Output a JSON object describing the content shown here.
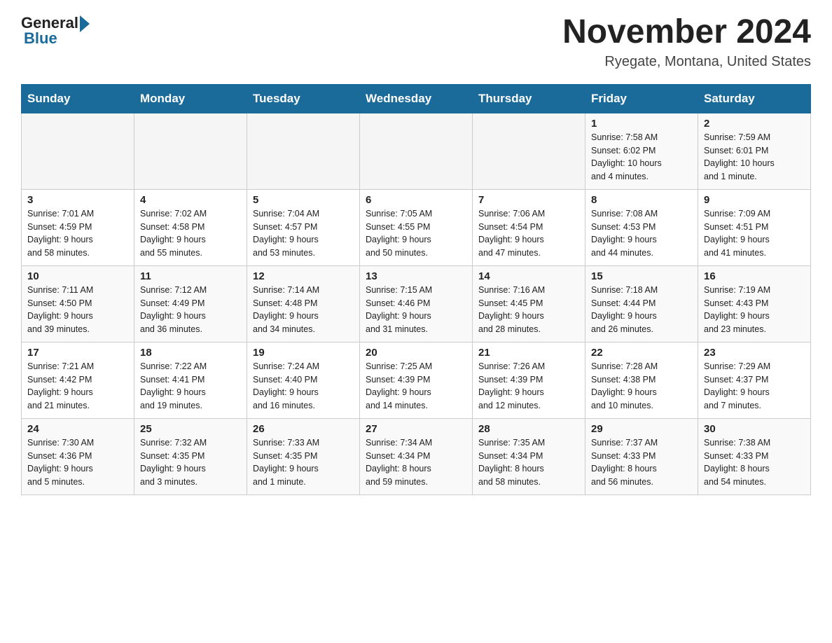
{
  "header": {
    "logo_general": "General",
    "logo_blue": "Blue",
    "month_title": "November 2024",
    "location": "Ryegate, Montana, United States"
  },
  "weekdays": [
    "Sunday",
    "Monday",
    "Tuesday",
    "Wednesday",
    "Thursday",
    "Friday",
    "Saturday"
  ],
  "weeks": [
    {
      "days": [
        {
          "num": "",
          "info": ""
        },
        {
          "num": "",
          "info": ""
        },
        {
          "num": "",
          "info": ""
        },
        {
          "num": "",
          "info": ""
        },
        {
          "num": "",
          "info": ""
        },
        {
          "num": "1",
          "info": "Sunrise: 7:58 AM\nSunset: 6:02 PM\nDaylight: 10 hours\nand 4 minutes."
        },
        {
          "num": "2",
          "info": "Sunrise: 7:59 AM\nSunset: 6:01 PM\nDaylight: 10 hours\nand 1 minute."
        }
      ]
    },
    {
      "days": [
        {
          "num": "3",
          "info": "Sunrise: 7:01 AM\nSunset: 4:59 PM\nDaylight: 9 hours\nand 58 minutes."
        },
        {
          "num": "4",
          "info": "Sunrise: 7:02 AM\nSunset: 4:58 PM\nDaylight: 9 hours\nand 55 minutes."
        },
        {
          "num": "5",
          "info": "Sunrise: 7:04 AM\nSunset: 4:57 PM\nDaylight: 9 hours\nand 53 minutes."
        },
        {
          "num": "6",
          "info": "Sunrise: 7:05 AM\nSunset: 4:55 PM\nDaylight: 9 hours\nand 50 minutes."
        },
        {
          "num": "7",
          "info": "Sunrise: 7:06 AM\nSunset: 4:54 PM\nDaylight: 9 hours\nand 47 minutes."
        },
        {
          "num": "8",
          "info": "Sunrise: 7:08 AM\nSunset: 4:53 PM\nDaylight: 9 hours\nand 44 minutes."
        },
        {
          "num": "9",
          "info": "Sunrise: 7:09 AM\nSunset: 4:51 PM\nDaylight: 9 hours\nand 41 minutes."
        }
      ]
    },
    {
      "days": [
        {
          "num": "10",
          "info": "Sunrise: 7:11 AM\nSunset: 4:50 PM\nDaylight: 9 hours\nand 39 minutes."
        },
        {
          "num": "11",
          "info": "Sunrise: 7:12 AM\nSunset: 4:49 PM\nDaylight: 9 hours\nand 36 minutes."
        },
        {
          "num": "12",
          "info": "Sunrise: 7:14 AM\nSunset: 4:48 PM\nDaylight: 9 hours\nand 34 minutes."
        },
        {
          "num": "13",
          "info": "Sunrise: 7:15 AM\nSunset: 4:46 PM\nDaylight: 9 hours\nand 31 minutes."
        },
        {
          "num": "14",
          "info": "Sunrise: 7:16 AM\nSunset: 4:45 PM\nDaylight: 9 hours\nand 28 minutes."
        },
        {
          "num": "15",
          "info": "Sunrise: 7:18 AM\nSunset: 4:44 PM\nDaylight: 9 hours\nand 26 minutes."
        },
        {
          "num": "16",
          "info": "Sunrise: 7:19 AM\nSunset: 4:43 PM\nDaylight: 9 hours\nand 23 minutes."
        }
      ]
    },
    {
      "days": [
        {
          "num": "17",
          "info": "Sunrise: 7:21 AM\nSunset: 4:42 PM\nDaylight: 9 hours\nand 21 minutes."
        },
        {
          "num": "18",
          "info": "Sunrise: 7:22 AM\nSunset: 4:41 PM\nDaylight: 9 hours\nand 19 minutes."
        },
        {
          "num": "19",
          "info": "Sunrise: 7:24 AM\nSunset: 4:40 PM\nDaylight: 9 hours\nand 16 minutes."
        },
        {
          "num": "20",
          "info": "Sunrise: 7:25 AM\nSunset: 4:39 PM\nDaylight: 9 hours\nand 14 minutes."
        },
        {
          "num": "21",
          "info": "Sunrise: 7:26 AM\nSunset: 4:39 PM\nDaylight: 9 hours\nand 12 minutes."
        },
        {
          "num": "22",
          "info": "Sunrise: 7:28 AM\nSunset: 4:38 PM\nDaylight: 9 hours\nand 10 minutes."
        },
        {
          "num": "23",
          "info": "Sunrise: 7:29 AM\nSunset: 4:37 PM\nDaylight: 9 hours\nand 7 minutes."
        }
      ]
    },
    {
      "days": [
        {
          "num": "24",
          "info": "Sunrise: 7:30 AM\nSunset: 4:36 PM\nDaylight: 9 hours\nand 5 minutes."
        },
        {
          "num": "25",
          "info": "Sunrise: 7:32 AM\nSunset: 4:35 PM\nDaylight: 9 hours\nand 3 minutes."
        },
        {
          "num": "26",
          "info": "Sunrise: 7:33 AM\nSunset: 4:35 PM\nDaylight: 9 hours\nand 1 minute."
        },
        {
          "num": "27",
          "info": "Sunrise: 7:34 AM\nSunset: 4:34 PM\nDaylight: 8 hours\nand 59 minutes."
        },
        {
          "num": "28",
          "info": "Sunrise: 7:35 AM\nSunset: 4:34 PM\nDaylight: 8 hours\nand 58 minutes."
        },
        {
          "num": "29",
          "info": "Sunrise: 7:37 AM\nSunset: 4:33 PM\nDaylight: 8 hours\nand 56 minutes."
        },
        {
          "num": "30",
          "info": "Sunrise: 7:38 AM\nSunset: 4:33 PM\nDaylight: 8 hours\nand 54 minutes."
        }
      ]
    }
  ]
}
